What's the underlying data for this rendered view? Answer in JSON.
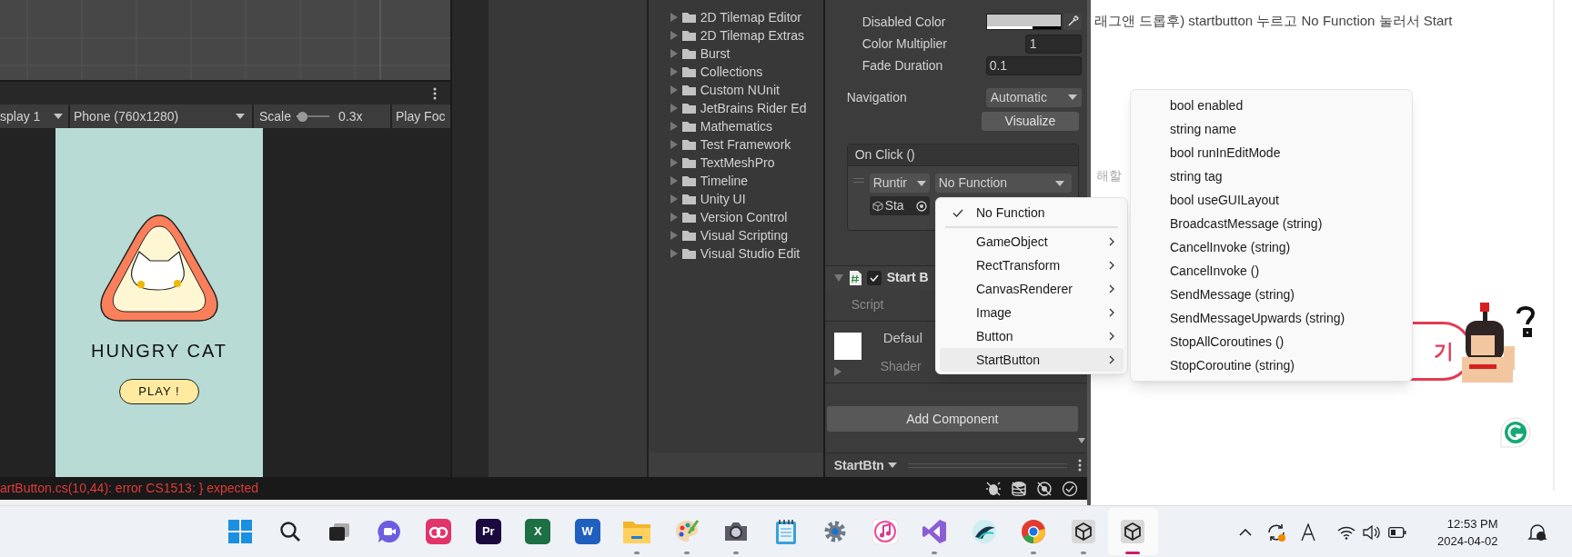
{
  "game_toolbar": {
    "display": "splay 1",
    "resolution": "Phone (760x1280)",
    "scale_label": "Scale",
    "scale": {
      "level": 0.05
    },
    "scale_reading": "0.3x",
    "play_focus": "Play Foc"
  },
  "game_view": {
    "title": "HUNGRY CAT",
    "button": "PLAY !"
  },
  "console_error": "artButton.cs(10,44): error CS1513: } expected",
  "project_folders": [
    "2D Tilemap Editor",
    "2D Tilemap Extras",
    "Burst",
    "Collections",
    "Custom NUnit",
    "JetBrains Rider Ed",
    "Mathematics",
    "Test Framework",
    "TextMeshPro",
    "Timeline",
    "Unity UI",
    "Version Control",
    "Visual Scripting",
    "Visual Studio Edit"
  ],
  "inspector": {
    "fields": [
      {
        "label": "Disabled Color",
        "kind": "color",
        "color": "#c8c8c8"
      },
      {
        "label": "Color Multiplier",
        "kind": "short",
        "value": "1"
      },
      {
        "label": "Fade Duration",
        "kind": "number",
        "value": "0.1"
      },
      {
        "label": "Navigation",
        "kind": "dropdown",
        "value": "Automatic"
      }
    ],
    "visualize_button": "Visualize",
    "on_click": {
      "title": "On Click ()",
      "runtime": "Runtir",
      "function": "No Function",
      "target": "Sta"
    },
    "component": {
      "title": "Start B",
      "enabled": true,
      "script_label": "Script"
    },
    "material": {
      "name": "Defaul",
      "shader_label": "Shader"
    },
    "add_component": "Add Component",
    "footer": "StartBtn"
  },
  "function_menu": [
    {
      "kind": "item",
      "label": "No Function",
      "checked": true,
      "selected": false
    },
    {
      "kind": "separator"
    },
    {
      "kind": "submenu",
      "label": "GameObject",
      "checked": false,
      "selected": false
    },
    {
      "kind": "submenu",
      "label": "RectTransform",
      "checked": false,
      "selected": false
    },
    {
      "kind": "submenu",
      "label": "CanvasRenderer",
      "checked": false,
      "selected": false
    },
    {
      "kind": "submenu",
      "label": "Image",
      "checked": false,
      "selected": false
    },
    {
      "kind": "submenu",
      "label": "Button",
      "checked": false,
      "selected": false
    },
    {
      "kind": "submenu",
      "label": "StartButton",
      "checked": false,
      "selected": true
    }
  ],
  "submenu": [
    "bool enabled",
    "string name",
    "bool runInEditMode",
    "string tag",
    "bool useGUILayout",
    "BroadcastMessage (string)",
    "CancelInvoke (string)",
    "CancelInvoke ()",
    "SendMessage (string)",
    "SendMessageUpwards (string)",
    "StopAllCoroutines ()",
    "StopCoroutine (string)"
  ],
  "blog": {
    "text": "래그앤 드롭후) startbutton 누르고 No Function 눌러서 Start",
    "faded_text": "해할",
    "button_text": "기"
  },
  "taskbar": {
    "apps": [
      {
        "kind": "windows",
        "running": false,
        "active": false
      },
      {
        "kind": "search",
        "running": false,
        "active": false
      },
      {
        "kind": "taskview",
        "running": false,
        "active": false
      },
      {
        "kind": "chat",
        "running": false,
        "active": false
      },
      {
        "kind": "swirl",
        "running": false,
        "active": false
      },
      {
        "kind": "tile",
        "label": "Pr",
        "color": "#1a0a3f",
        "running": false,
        "active": false
      },
      {
        "kind": "tile",
        "label": "X",
        "color": "#1d7044",
        "running": false,
        "active": false
      },
      {
        "kind": "tile",
        "label": "W",
        "color": "#1f5fbf",
        "running": false,
        "active": false
      },
      {
        "kind": "folder",
        "running": true,
        "active": false
      },
      {
        "kind": "palette",
        "running": true,
        "active": false
      },
      {
        "kind": "camera",
        "running": true,
        "active": false
      },
      {
        "kind": "notepad",
        "running": false,
        "active": false
      },
      {
        "kind": "settings",
        "running": false,
        "active": false
      },
      {
        "kind": "music",
        "running": false,
        "active": false
      },
      {
        "kind": "ribbon",
        "running": true,
        "active": false
      },
      {
        "kind": "wave",
        "running": false,
        "active": false
      },
      {
        "kind": "browser",
        "running": true,
        "active": false
      },
      {
        "kind": "cube",
        "running": true,
        "active": false
      },
      {
        "kind": "cube",
        "running": true,
        "active": true
      }
    ],
    "time": "12:53 PM",
    "date": "2024-04-02"
  }
}
